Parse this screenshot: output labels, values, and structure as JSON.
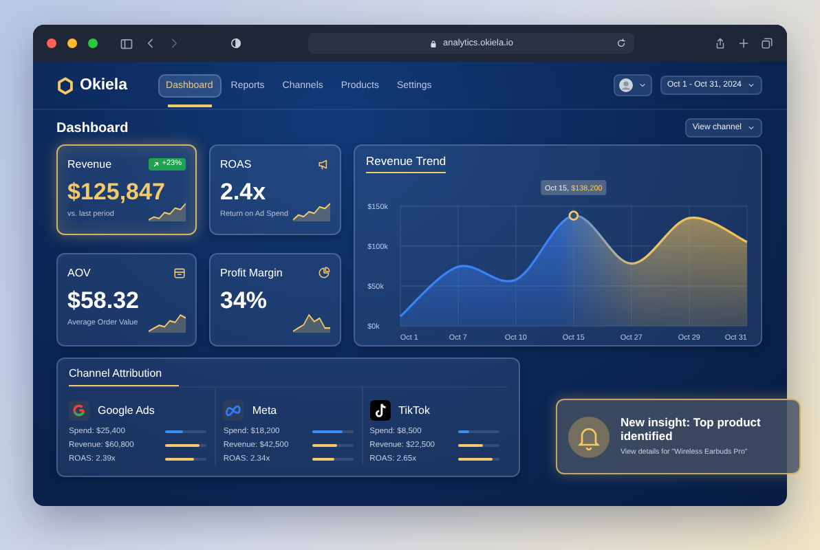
{
  "browser": {
    "url": "analytics.okiela.io"
  },
  "brand": {
    "name": "Okiela"
  },
  "nav": [
    {
      "label": "Dashboard",
      "selected": true
    },
    {
      "label": "Reports",
      "selected": false
    },
    {
      "label": "Channels",
      "selected": false
    },
    {
      "label": "Products",
      "selected": false
    },
    {
      "label": "Settings",
      "selected": false
    }
  ],
  "date_range": "Oct 1 - Oct 31, 2024",
  "page_title": "Dashboard",
  "view_button": "View channel",
  "metrics": [
    {
      "title": "Revenue",
      "value": "$125,847",
      "caption": "vs. last period",
      "badge": "+23%",
      "highlighted": true
    },
    {
      "title": "ROAS",
      "value": "2.4x",
      "caption": "Return on Ad Spend",
      "highlighted": false
    },
    {
      "title": "AOV",
      "value": "$58.32",
      "caption": "Average Order Value",
      "highlighted": false
    },
    {
      "title": "Profit Margin",
      "value": "34%",
      "highlighted": false
    }
  ],
  "revenue_trend": {
    "title": "Revenue Trend",
    "chart_data": {
      "type": "area",
      "categories": [
        "Oct 1",
        "Oct 7",
        "Oct 10",
        "Oct 15",
        "Oct 27",
        "Oct 29",
        "Oct 31"
      ],
      "grid": true,
      "series": [
        {
          "color": "#3b82f6",
          "values": [
            12000,
            74000,
            58000,
            138000,
            78000,
            135000,
            105000
          ]
        }
      ],
      "ylim": [
        0,
        150000
      ],
      "yticks": [
        {
          "value": 0,
          "label": "$0k"
        },
        {
          "value": 50000,
          "label": "$50k"
        },
        {
          "value": 100000,
          "label": "$100k"
        },
        {
          "value": 150000,
          "label": "$150k"
        }
      ],
      "annotations": [
        {
          "x": "Oct 15",
          "y": 138000,
          "text": "Oct 15, $138,200"
        }
      ]
    }
  },
  "channel_attribution": {
    "title": "Channel Attribution",
    "channels": [
      {
        "name": "Google Ads",
        "stats": [
          {
            "kind": "spend",
            "text": "Spend: $25,400",
            "level": 0.42
          },
          {
            "kind": "revenue",
            "text": "Revenue: $60,800",
            "level": 0.82
          },
          {
            "kind": "roas",
            "text": "ROAS: 2.39x",
            "level": 0.68
          }
        ]
      },
      {
        "name": "Meta",
        "stats": [
          {
            "kind": "spend",
            "text": "Spend: $18,200",
            "level": 0.75
          },
          {
            "kind": "revenue",
            "text": "Revenue: $42,500",
            "level": 0.6
          },
          {
            "kind": "roas",
            "text": "ROAS: 2.34x",
            "level": 0.55
          }
        ]
      },
      {
        "name": "TikTok",
        "stats": [
          {
            "kind": "spend",
            "text": "Spend: $8,500",
            "level": 0.27
          },
          {
            "kind": "revenue",
            "text": "Revenue: $22,500",
            "level": 0.6
          },
          {
            "kind": "roas",
            "text": "ROAS: 2.65x",
            "level": 0.82
          }
        ]
      }
    ]
  },
  "insight": {
    "title": "New insight: Top product identified",
    "detail": "View details for \"Wireless Earbuds Pro\""
  }
}
